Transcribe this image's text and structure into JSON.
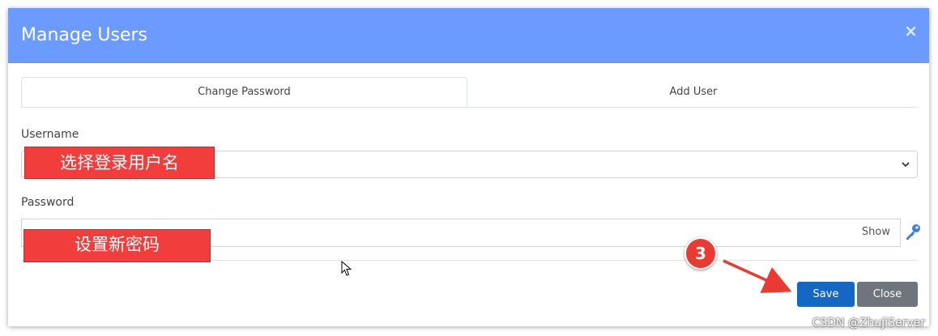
{
  "modal": {
    "title": "Manage Users",
    "close_glyph": "×"
  },
  "tabs": [
    {
      "label": "Change Password",
      "active": true
    },
    {
      "label": "Add User",
      "active": false
    }
  ],
  "form": {
    "username_label": "Username",
    "username_value": "",
    "password_label": "Password",
    "password_value": "",
    "show_label": "Show",
    "key_icon": "key-icon"
  },
  "buttons": {
    "save_label": "Save",
    "close_label": "Close"
  },
  "annotations": {
    "username_note": "选择登录用户名",
    "password_note": "设置新密码",
    "step_marker": "3"
  },
  "watermark": "CSDN @ZhujiServer",
  "colors": {
    "header": "#6c9bff",
    "save": "#1468c3",
    "close": "#6e757c",
    "annotation": "#f23d3d"
  }
}
